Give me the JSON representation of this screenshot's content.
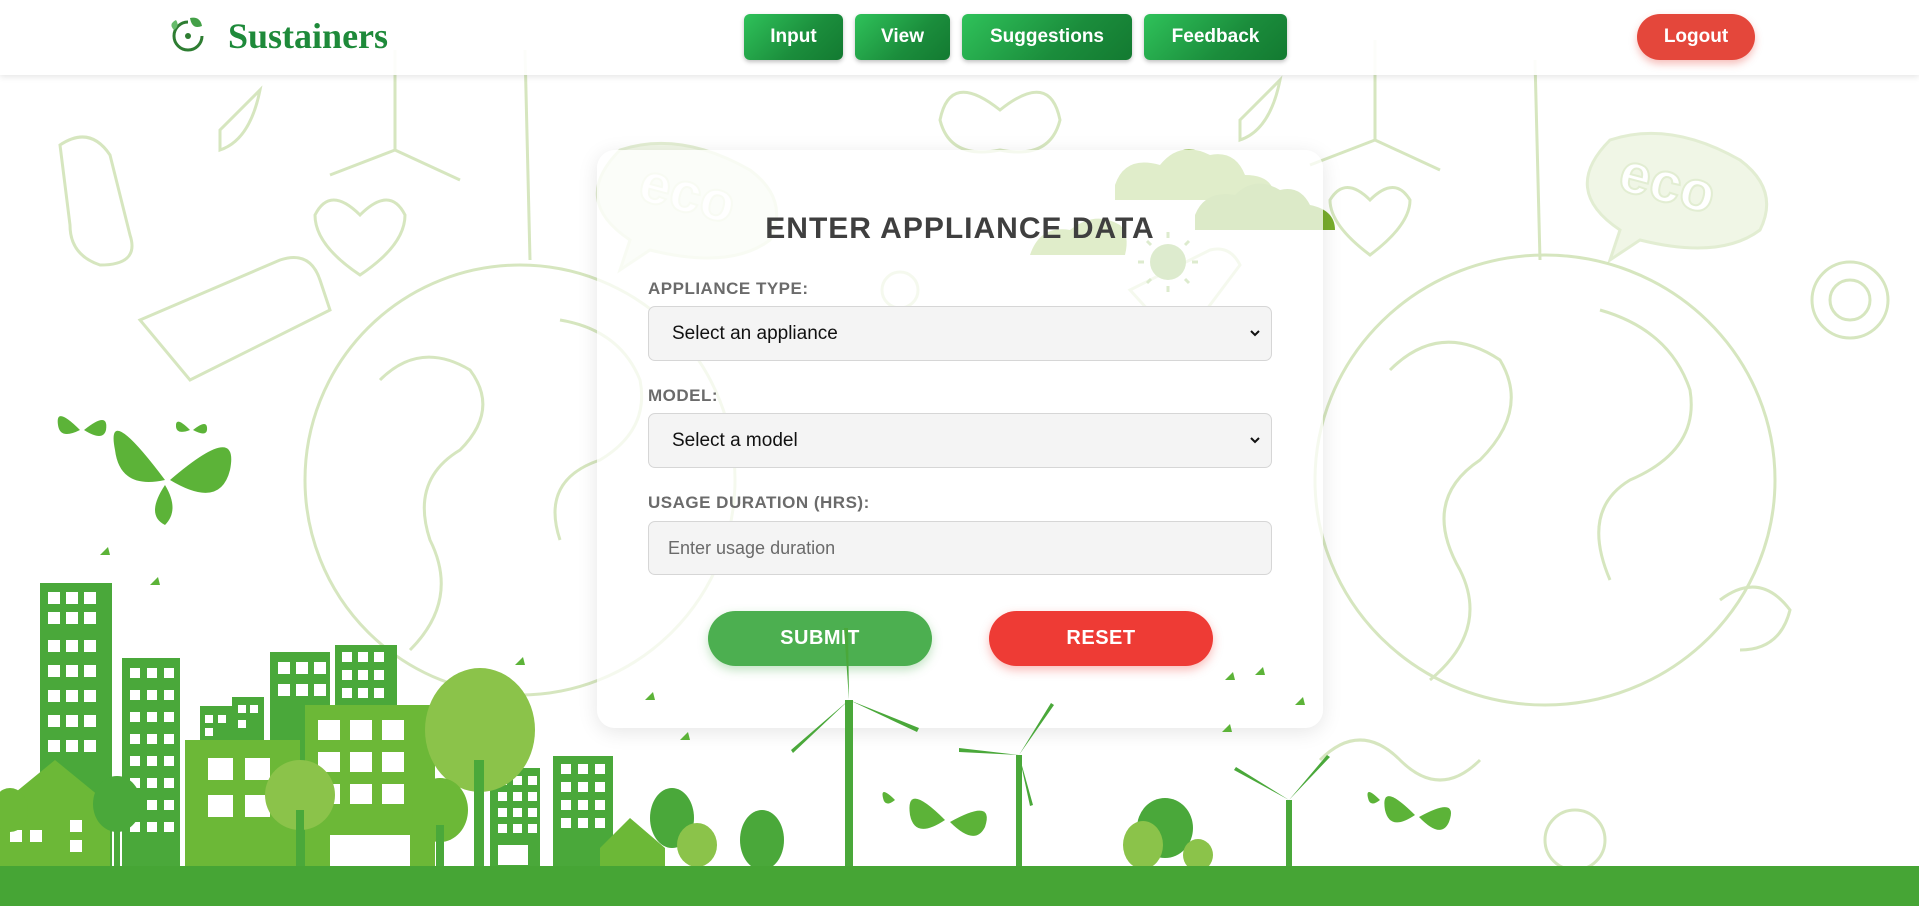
{
  "brand": {
    "name": "Sustainers",
    "logo_icon": "leaf-swirl-icon"
  },
  "nav": {
    "items": [
      {
        "label": "Input"
      },
      {
        "label": "View"
      },
      {
        "label": "Suggestions"
      },
      {
        "label": "Feedback"
      }
    ],
    "logout_label": "Logout"
  },
  "form": {
    "title": "ENTER APPLIANCE DATA",
    "appliance_type": {
      "label": "APPLIANCE TYPE:",
      "selected": "Select an appliance"
    },
    "model": {
      "label": "MODEL:",
      "selected": "Select a model"
    },
    "usage": {
      "label": "USAGE DURATION (HRS):",
      "placeholder": "Enter usage duration",
      "value": ""
    },
    "submit_label": "SUBMIT",
    "reset_label": "RESET"
  },
  "background": {
    "doodle_word": "eco",
    "theme_colors": {
      "primary_green": "#1e8a3a",
      "light_green": "#4caf50",
      "danger_red": "#e4473b",
      "ground": "#46a535"
    }
  }
}
